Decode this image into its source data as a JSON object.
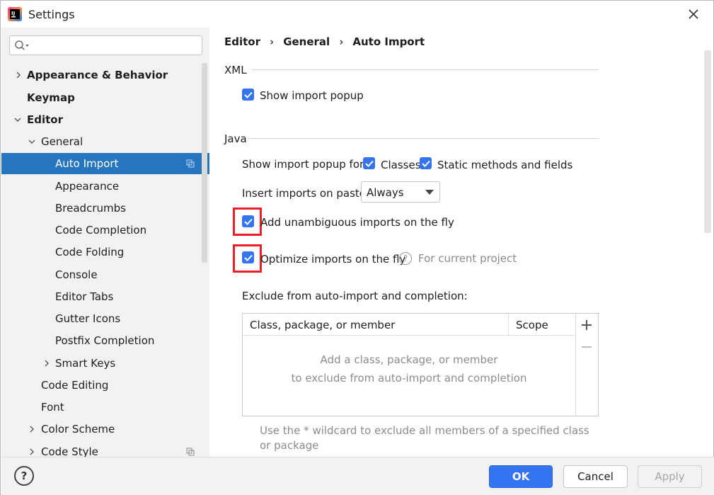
{
  "window": {
    "title": "Settings"
  },
  "sidebar": {
    "search_placeholder": "",
    "items": [
      {
        "label": "Appearance & Behavior"
      },
      {
        "label": "Keymap"
      },
      {
        "label": "Editor"
      },
      {
        "label": "General"
      },
      {
        "label": "Auto Import"
      },
      {
        "label": "Appearance"
      },
      {
        "label": "Breadcrumbs"
      },
      {
        "label": "Code Completion"
      },
      {
        "label": "Code Folding"
      },
      {
        "label": "Console"
      },
      {
        "label": "Editor Tabs"
      },
      {
        "label": "Gutter Icons"
      },
      {
        "label": "Postfix Completion"
      },
      {
        "label": "Smart Keys"
      },
      {
        "label": "Code Editing"
      },
      {
        "label": "Font"
      },
      {
        "label": "Color Scheme"
      },
      {
        "label": "Code Style"
      }
    ]
  },
  "breadcrumb": {
    "items": [
      "Editor",
      "General",
      "Auto Import"
    ]
  },
  "xml": {
    "section_title": "XML",
    "show_import_popup": {
      "label": "Show import popup",
      "checked": true
    }
  },
  "java": {
    "section_title": "Java",
    "show_popup_for_label": "Show import popup for:",
    "classes": {
      "label": "Classes",
      "checked": true
    },
    "static_methods": {
      "label": "Static methods and fields",
      "checked": true
    },
    "insert_on_paste_label": "Insert imports on paste:",
    "insert_on_paste_value": "Always",
    "add_unambiguous": {
      "label": "Add unambiguous imports on the fly",
      "checked": true
    },
    "optimize_imports": {
      "label": "Optimize imports on the fly",
      "checked": true
    },
    "for_current_project": "For current project",
    "exclude_label": "Exclude from auto-import and completion:",
    "table": {
      "col_class": "Class, package, or member",
      "col_scope": "Scope",
      "empty_line1": "Add a class, package, or member",
      "empty_line2": "to exclude from auto-import and completion"
    },
    "hint": "Use the * wildcard to exclude all members of a specified class or package"
  },
  "footer": {
    "help": "?",
    "ok": "OK",
    "cancel": "Cancel",
    "apply": "Apply"
  },
  "colors": {
    "accent": "#3574f0",
    "selection": "#2675bf",
    "highlight_box": "#e8202a"
  }
}
